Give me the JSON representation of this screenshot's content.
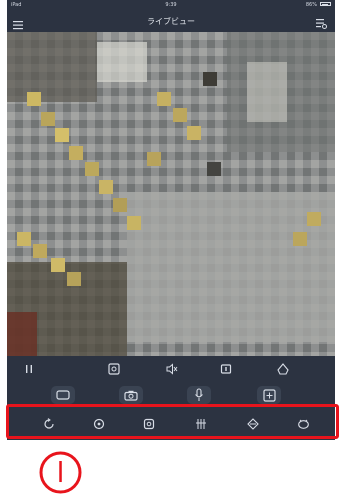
{
  "status_bar": {
    "carrier": "iPad",
    "time": "9:39",
    "battery": "86%"
  },
  "header": {
    "title": "ライブビュー"
  },
  "icons": {
    "menu": "hamburger-menu-icon",
    "settings": "settings-icon",
    "row1": [
      "pause-icon",
      "screenshot-icon",
      "mute-icon",
      "stream-quality-icon",
      "fullscreen-icon"
    ],
    "row2": [
      "video-record-icon",
      "camera-icon",
      "microphone-icon",
      "zoom-box-icon"
    ],
    "row3": [
      "replay-icon",
      "ptz-icon",
      "search-icon",
      "night-vision-icon",
      "motion-icon",
      "alarm-icon"
    ]
  },
  "colors": {
    "background": "#2c3341",
    "icon": "#d8dde6",
    "highlight": "#e8141c"
  },
  "annotation": {
    "marker": "①"
  }
}
